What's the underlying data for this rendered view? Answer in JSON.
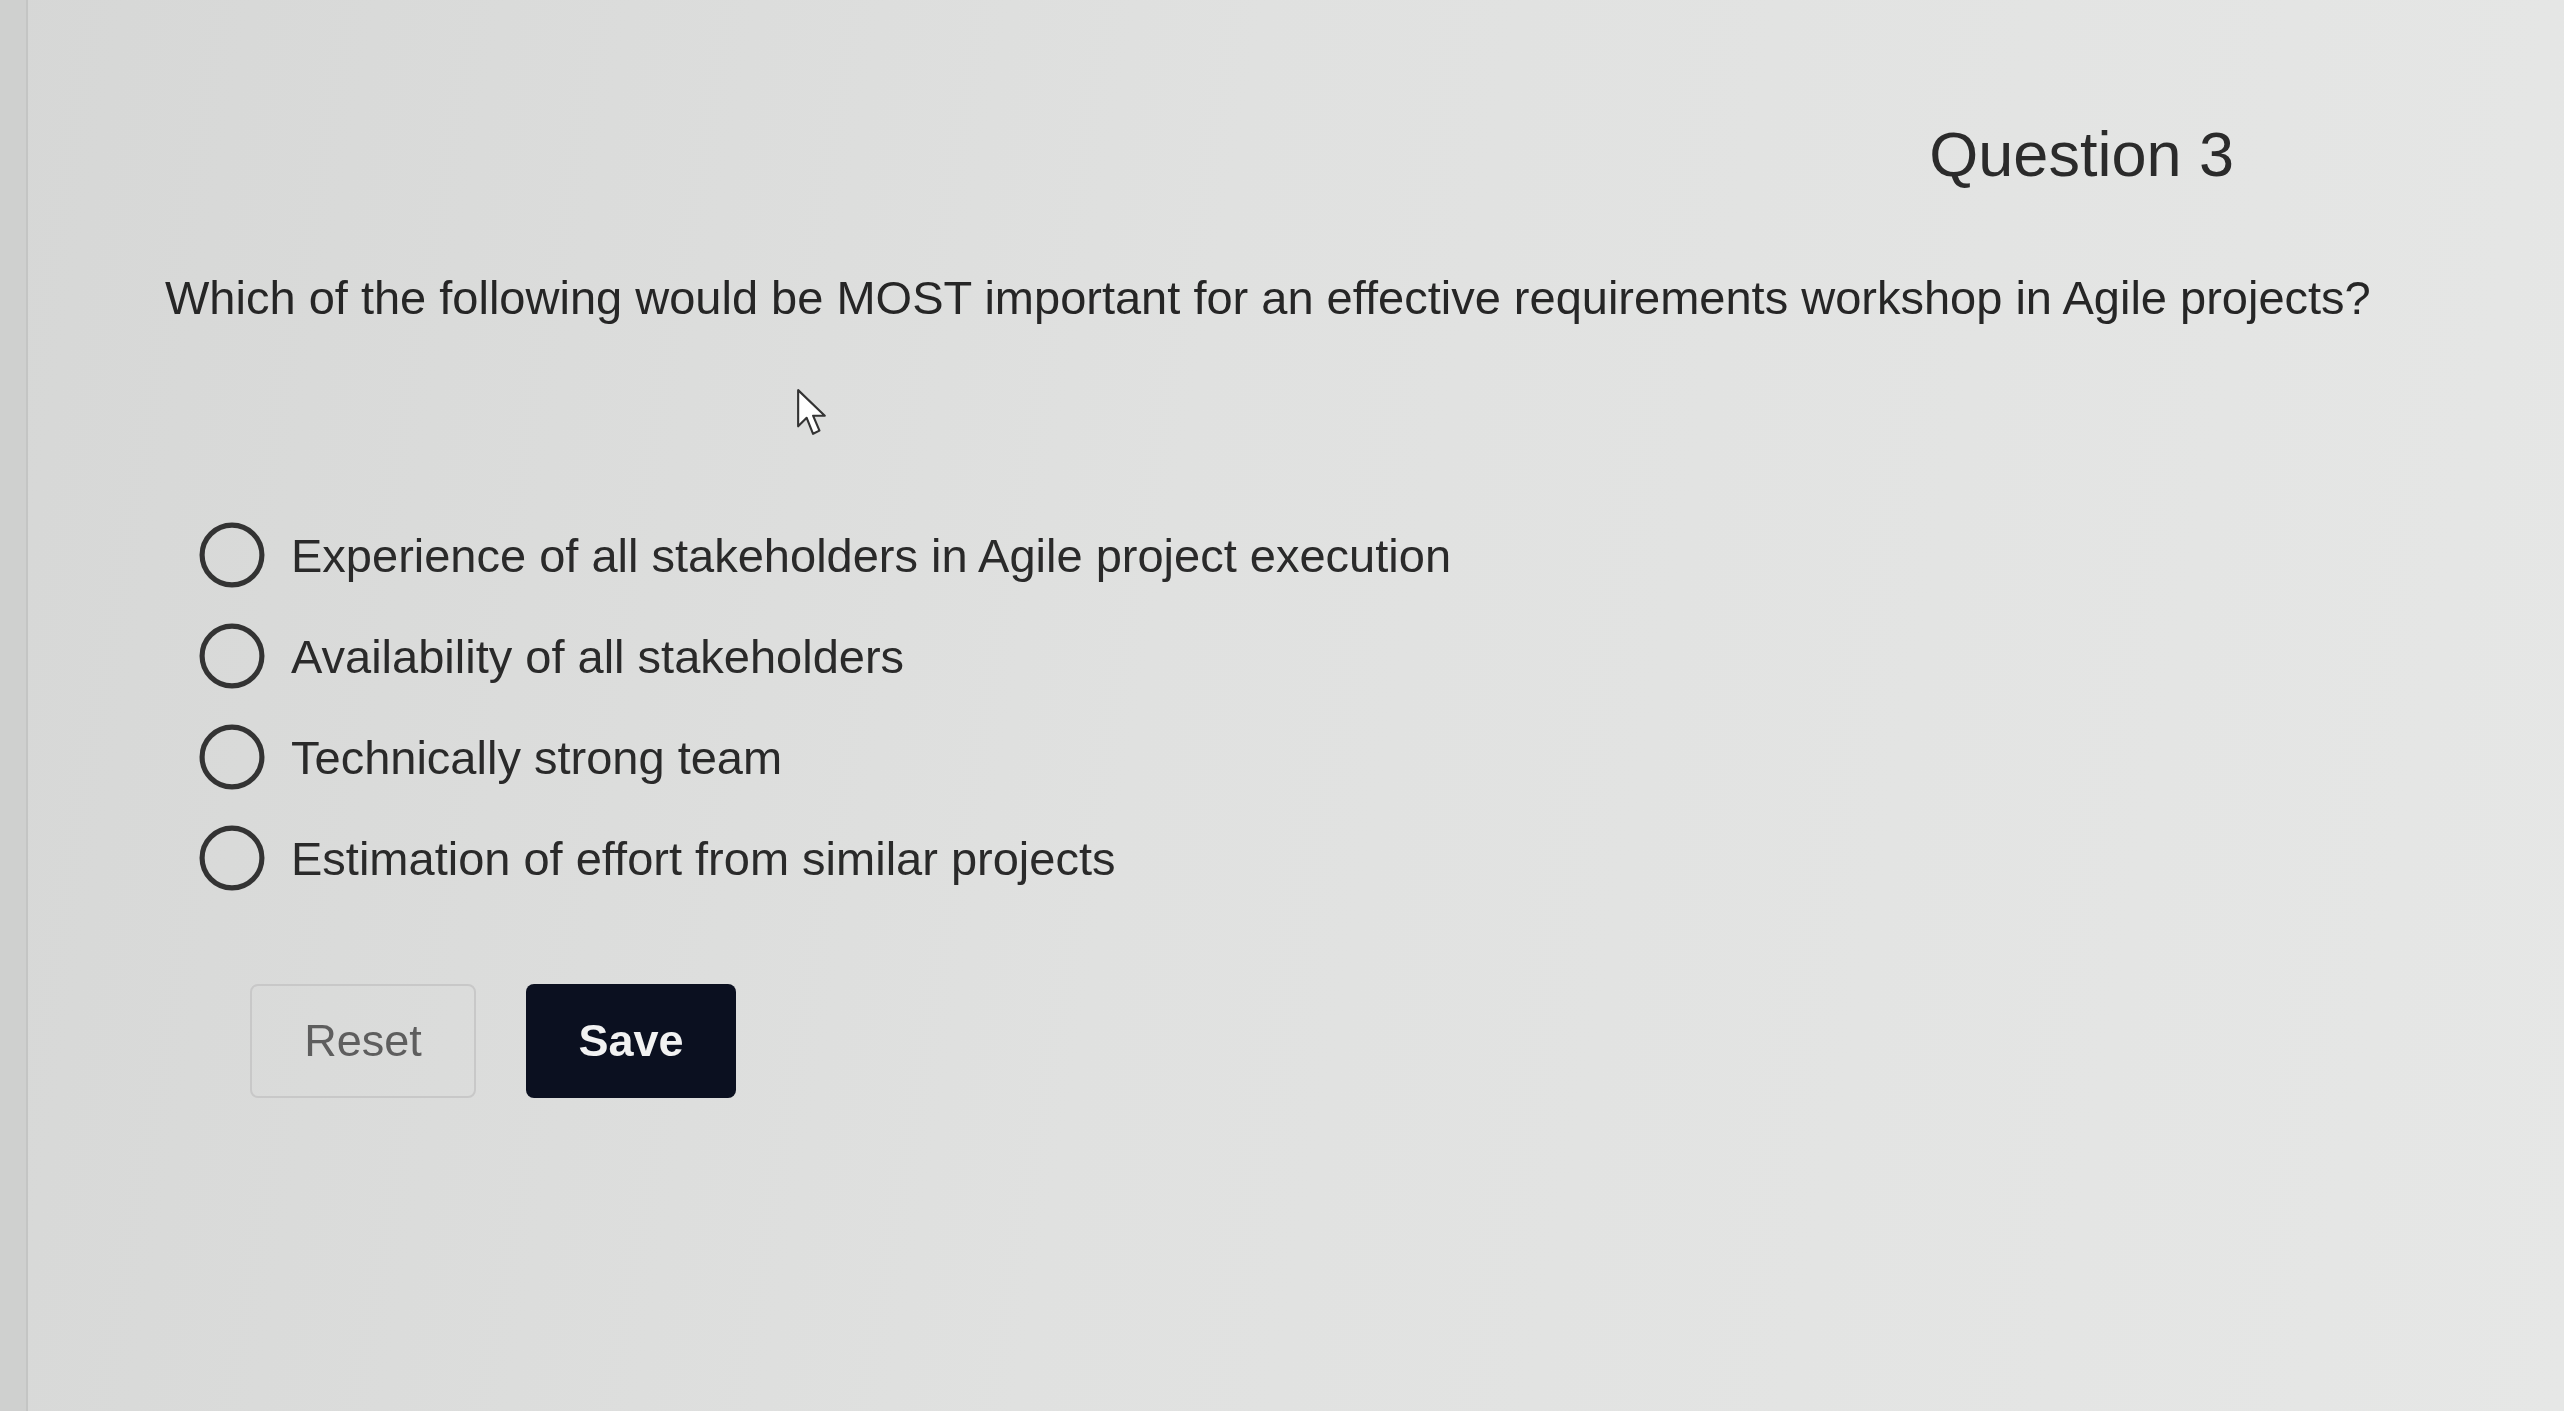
{
  "question": {
    "title": "Question 3",
    "text": "Which of the following would be MOST important for an effective requirements workshop in Agile projects?"
  },
  "options": [
    {
      "label": "Experience of all stakeholders in Agile project execution",
      "selected": false
    },
    {
      "label": "Availability of all stakeholders",
      "selected": false
    },
    {
      "label": "Technically strong team",
      "selected": false
    },
    {
      "label": "Estimation of effort from similar projects",
      "selected": false
    }
  ],
  "buttons": [
    {
      "label": "Reset",
      "kind": "secondary"
    },
    {
      "label": "Save",
      "kind": "primary"
    }
  ]
}
